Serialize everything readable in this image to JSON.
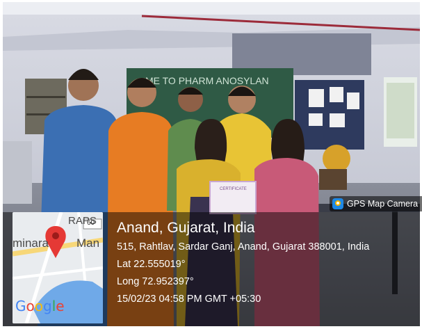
{
  "badge": {
    "label": "GPS Map Camera",
    "icon": "gps-map-camera-icon"
  },
  "location": {
    "place": "Anand, Gujarat, India",
    "address": "515, Rahtlav, Sardar Ganj, Anand, Gujarat 388001, India",
    "lat": "Lat 22.555019°",
    "long": "Long 72.952397°",
    "datetime": "15/02/23 04:58 PM GMT +05:30"
  },
  "map": {
    "label_raps": "RAPS",
    "road_number": "60",
    "label_left": "minara",
    "label_right": "Man",
    "brand": [
      "G",
      "o",
      "o",
      "g",
      "l",
      "e"
    ],
    "brand_colors": [
      "#4285F4",
      "#EA4335",
      "#FBBC05",
      "#4285F4",
      "#34A853",
      "#EA4335"
    ],
    "pin_color": "#e53935"
  },
  "photo": {
    "board_text": "ME TO PHARM ANOSYLAN",
    "certificate_text": "CERTIFICATE"
  }
}
